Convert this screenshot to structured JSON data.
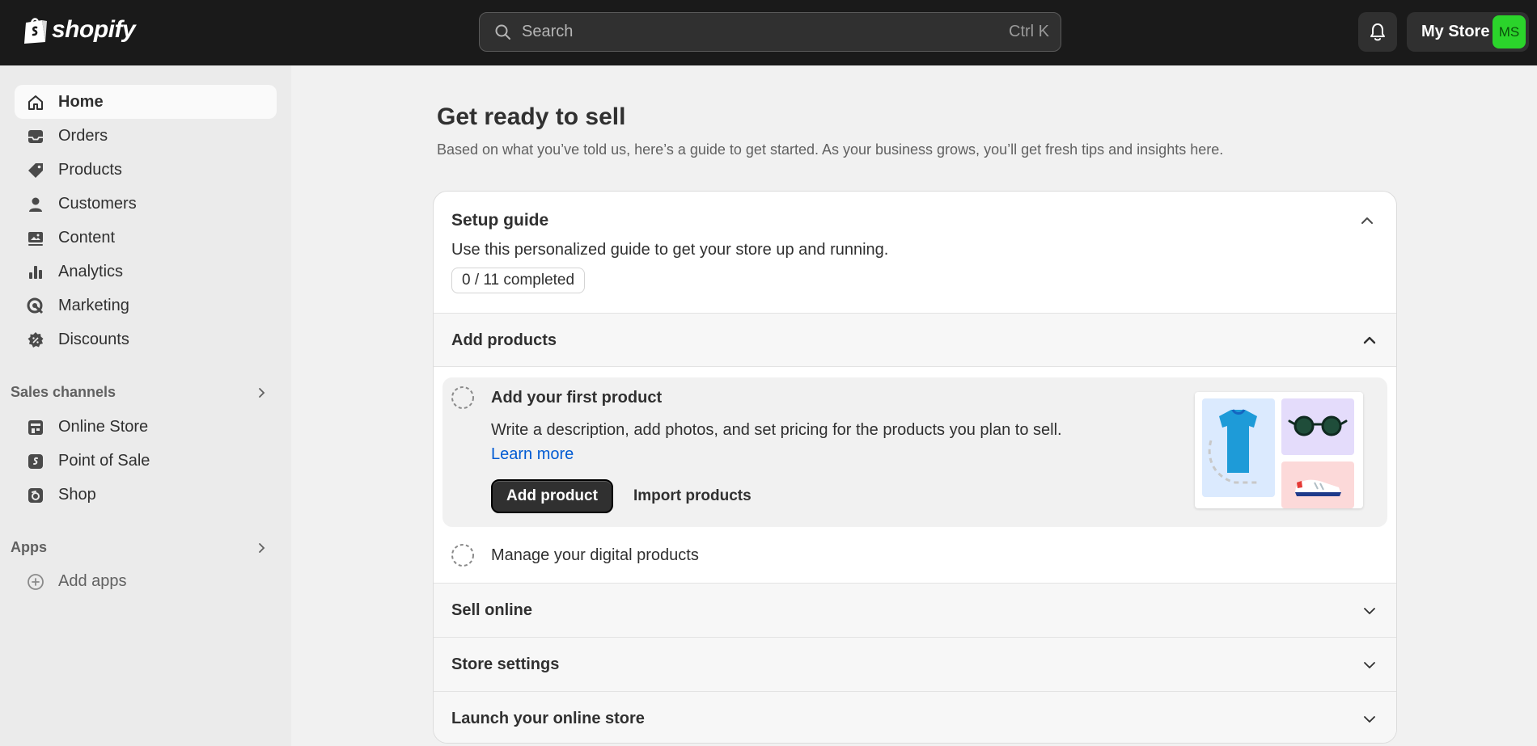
{
  "topbar": {
    "logo_text": "shopify",
    "search_placeholder": "Search",
    "search_shortcut": "Ctrl K",
    "store_name": "My Store",
    "avatar_initials": "MS",
    "avatar_color": "#2bd42b"
  },
  "sidebar": {
    "items": [
      {
        "label": "Home",
        "icon": "home-icon",
        "active": true
      },
      {
        "label": "Orders",
        "icon": "inbox-icon"
      },
      {
        "label": "Products",
        "icon": "tag-icon"
      },
      {
        "label": "Customers",
        "icon": "person-icon"
      },
      {
        "label": "Content",
        "icon": "image-icon"
      },
      {
        "label": "Analytics",
        "icon": "bar-chart-icon"
      },
      {
        "label": "Marketing",
        "icon": "target-icon"
      },
      {
        "label": "Discounts",
        "icon": "discount-icon"
      }
    ],
    "sales_channels": {
      "title": "Sales channels",
      "items": [
        {
          "label": "Online Store",
          "icon": "storefront-icon"
        },
        {
          "label": "Point of Sale",
          "icon": "pos-icon"
        },
        {
          "label": "Shop",
          "icon": "shop-icon"
        }
      ]
    },
    "apps": {
      "title": "Apps",
      "add_label": "Add apps"
    }
  },
  "main": {
    "title": "Get ready to sell",
    "subtitle": "Based on what you’ve told us, here’s a guide to get started. As your business grows, you’ll get fresh tips and insights here.",
    "setup_guide": {
      "title": "Setup guide",
      "description": "Use this personalized guide to get your store up and running.",
      "progress": "0 / 11 completed",
      "sections": {
        "add_products": {
          "title": "Add products",
          "task_active": {
            "title": "Add your first product",
            "description": "Write a description, add photos, and set pricing for the products you plan to sell.",
            "link": "Learn more",
            "primary_button": "Add product",
            "secondary_button": "Import products"
          },
          "task_digital": "Manage your digital products"
        },
        "sell_online": "Sell online",
        "store_settings": "Store settings",
        "launch": "Launch your online store"
      }
    }
  }
}
